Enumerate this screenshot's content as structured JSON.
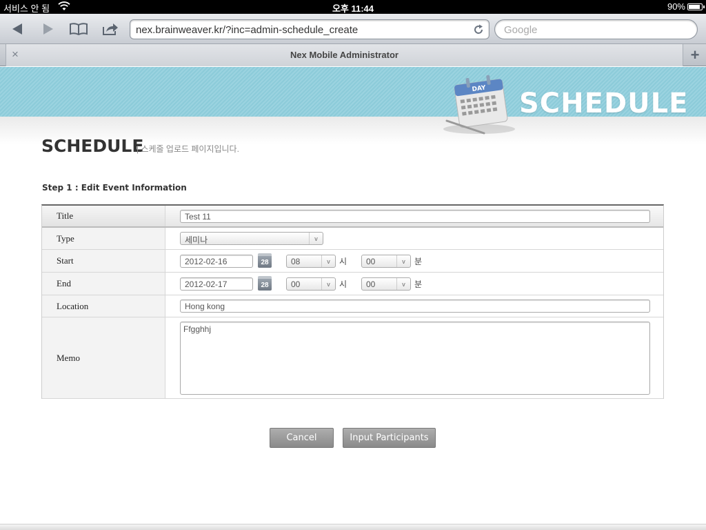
{
  "status_bar": {
    "carrier": "서비스 안 됨",
    "time": "오후 11:44",
    "battery": "90%",
    "battery_level": 0.9
  },
  "browser": {
    "url": "nex.brainweaver.kr/?inc=admin-schedule_create",
    "search_placeholder": "Google",
    "tab_title": "Nex Mobile Administrator",
    "tab_close": "×",
    "new_tab": "+"
  },
  "page": {
    "banner_word": "SCHEDULE",
    "banner_calendar_label": "DAY",
    "heading": "SCHEDULE",
    "subheading": "| 스케줄 업로드 페이지입니다.",
    "step": "Step 1 : Edit Event Information"
  },
  "form": {
    "title": {
      "label": "Title",
      "value": "Test 11"
    },
    "type": {
      "label": "Type",
      "value": "세미나"
    },
    "start": {
      "label": "Start",
      "date": "2012-02-16",
      "hour": "08",
      "minute": "00",
      "hour_unit": "시",
      "minute_unit": "분",
      "cal_day": "28"
    },
    "end": {
      "label": "End",
      "date": "2012-02-17",
      "hour": "00",
      "minute": "00",
      "hour_unit": "시",
      "minute_unit": "분",
      "cal_day": "28"
    },
    "location": {
      "label": "Location",
      "value": "Hong kong"
    },
    "memo": {
      "label": "Memo",
      "value": "Ffgghhj"
    }
  },
  "buttons": {
    "cancel": "Cancel",
    "next": "Input Participants"
  },
  "icons": [
    "back-icon",
    "forward-icon",
    "bookmarks-icon",
    "share-icon",
    "reload-icon",
    "wifi-icon",
    "battery-icon",
    "calendar-icon",
    "close-tab-icon",
    "new-tab-icon"
  ]
}
